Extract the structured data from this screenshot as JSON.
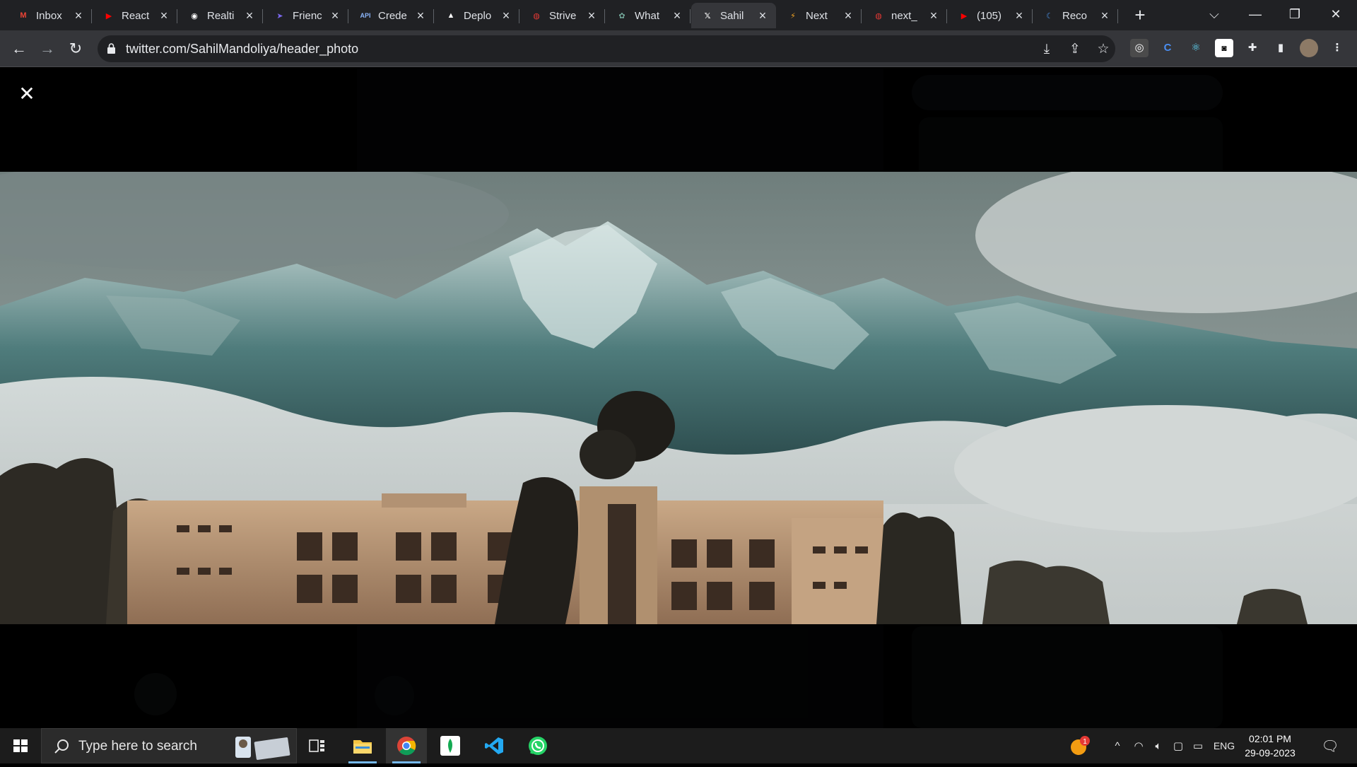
{
  "browser": {
    "tabs": [
      {
        "title": "Inbox",
        "icon": "gmail-icon",
        "color": "#ea4335"
      },
      {
        "title": "React",
        "icon": "youtube-icon",
        "color": "#ff0000"
      },
      {
        "title": "Realti",
        "icon": "github-icon",
        "color": "#ffffff"
      },
      {
        "title": "Frienc",
        "icon": "send-icon",
        "color": "#7b68ee"
      },
      {
        "title": "Crede",
        "icon": "api-icon",
        "color": "#8ab4f8"
      },
      {
        "title": "Deplo",
        "icon": "vercel-icon",
        "color": "#ffffff"
      },
      {
        "title": "Strive",
        "icon": "strive-icon",
        "color": "#e53935"
      },
      {
        "title": "What",
        "icon": "chatgpt-icon",
        "color": "#74aa9c"
      },
      {
        "title": "Sahil",
        "icon": "x-icon",
        "color": "#ffffff",
        "active": true
      },
      {
        "title": "Next",
        "icon": "next-icon",
        "color": "#f5a623"
      },
      {
        "title": "next_",
        "icon": "strive-icon",
        "color": "#e53935"
      },
      {
        "title": "(105)",
        "icon": "youtube-icon",
        "color": "#ff0000"
      },
      {
        "title": "Reco",
        "icon": "moon-icon",
        "color": "#4a90e2"
      }
    ],
    "url": "twitter.com/SahilMandoliya/header_photo"
  },
  "photo_viewer": {
    "image_description": "header-photo-mountains"
  },
  "taskbar": {
    "search_placeholder": "Type here to search",
    "language": "ENG",
    "time": "02:01 PM",
    "date": "29-09-2023",
    "notification_badge": "1"
  }
}
